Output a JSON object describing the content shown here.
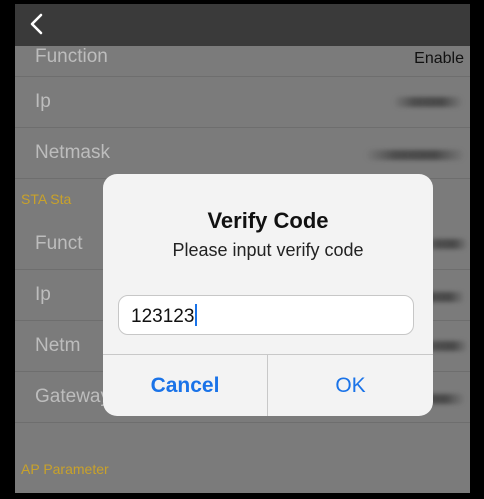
{
  "navbar": {
    "back_icon": "chevron-left-icon"
  },
  "rows": {
    "function_top": {
      "label": "Function",
      "value": "Enable"
    },
    "ip_top": {
      "label": "Ip"
    },
    "netmask_top": {
      "label": "Netmask"
    },
    "sta_section": {
      "label": "STA Sta"
    },
    "function_sta": {
      "label": "Funct"
    },
    "ip_sta": {
      "label": "Ip"
    },
    "netmask_sta": {
      "label": "Netm"
    },
    "gateway": {
      "label": "Gateway"
    },
    "ap_section": {
      "label": "AP Parameter"
    }
  },
  "dialog": {
    "title": "Verify Code",
    "message": "Please input verify code",
    "input_value": "123123",
    "cancel_label": "Cancel",
    "ok_label": "OK"
  },
  "colors": {
    "background": "#7b7b7b",
    "section_text": "#c9a22a",
    "accent": "#1a73e8",
    "dialog_bg": "#f3f3f3"
  }
}
